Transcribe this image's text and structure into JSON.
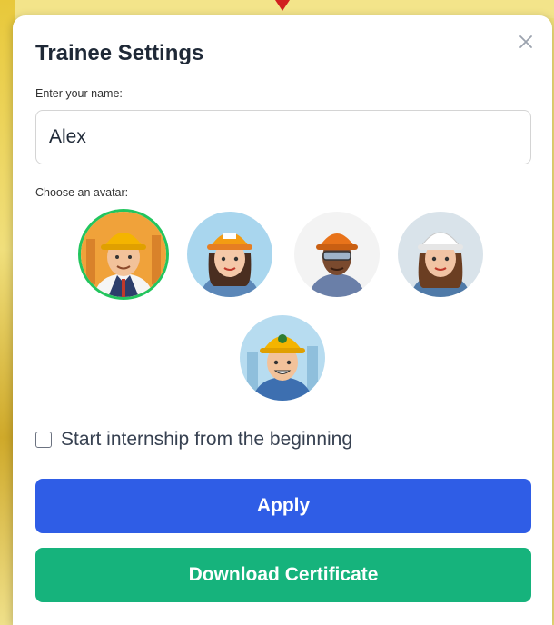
{
  "modal": {
    "title": "Trainee Settings",
    "close_icon": "close-icon",
    "name_label": "Enter your name:",
    "name_value": "Alex",
    "avatar_label": "Choose an avatar:",
    "avatars": [
      {
        "icon": "worker-avatar-icon",
        "selected": true
      },
      {
        "icon": "worker-avatar-icon",
        "selected": false
      },
      {
        "icon": "worker-avatar-icon",
        "selected": false
      },
      {
        "icon": "worker-avatar-icon",
        "selected": false
      },
      {
        "icon": "worker-avatar-icon",
        "selected": false
      }
    ],
    "checkbox_label": "Start internship from the beginning",
    "checkbox_checked": false,
    "apply_label": "Apply",
    "certificate_label": "Download Certificate"
  },
  "colors": {
    "apply": "#2f5de6",
    "certificate": "#16b37c",
    "selected_ring": "#22c55e",
    "background": "#f2e27a"
  }
}
